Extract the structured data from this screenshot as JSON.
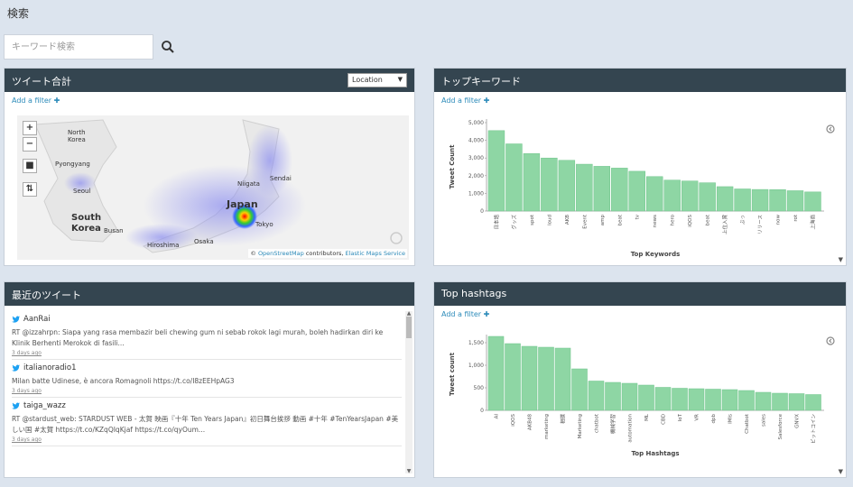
{
  "page": {
    "title": "検索"
  },
  "search": {
    "placeholder": "キーワード検索"
  },
  "panels": {
    "tweet_total": {
      "title": "ツイート合計",
      "select_value": "Location",
      "filter_label": "Add a filter"
    },
    "top_keywords": {
      "title": "トップキーワード",
      "filter_label": "Add a filter"
    },
    "recent_tweets": {
      "title": "最近のツイート"
    },
    "top_hashtags": {
      "title": "Top hashtags",
      "filter_label": "Add a filter"
    }
  },
  "map": {
    "labels": {
      "north_korea": "North\nKorea",
      "pyongyang": "Pyongyang",
      "seoul": "Seoul",
      "south_korea": "South\nKorea",
      "busan": "Busan",
      "japan": "Japan",
      "niigata": "Niigata",
      "sendai": "Sendai",
      "tokyo": "Tokyo",
      "osaka": "Osaka",
      "hiroshima": "Hiroshima"
    },
    "attribution_prefix": "© ",
    "attribution_osm": "OpenStreetMap",
    "attribution_mid": " contributors, ",
    "attribution_ems": "Elastic Maps Service"
  },
  "tweets": [
    {
      "user": "AanRai",
      "text": "RT @izzahrpn: Siapa yang rasa membazir beli chewing gum ni sebab rokok lagi murah, boleh hadirkan diri ke Klinik Berhenti Merokok di fasili...",
      "time": "3 days ago"
    },
    {
      "user": "italianoradio1",
      "text": "Milan batte Udinese, è ancora Romagnoli https://t.co/I8zEEHpAG3",
      "time": "3 days ago"
    },
    {
      "user": "taiga_wazz",
      "text": "RT @stardust_web: STARDUST WEB - 太賀 映画『十年 Ten Years Japan』初日舞台挨拶 動画 #十年 #TenYearsJapan #美しい国 #太賀 https://t.co/KZqQIqKjaf https://t.co/qyOum...",
      "time": "3 days ago"
    }
  ],
  "colors": {
    "header": "#344550",
    "bar": "#8ed6a4",
    "bar_stroke": "#6fc48b",
    "link": "#2b8ab9",
    "background": "#dce4ee"
  },
  "chart_data": [
    {
      "type": "bar",
      "title": "",
      "xlabel": "Top Keywords",
      "ylabel": "Tweet Count",
      "ylim": [
        0,
        5000
      ],
      "yticks": [
        "0",
        "1,000",
        "2,000",
        "3,000",
        "4,000",
        "5,000"
      ],
      "categories": [
        "日本語",
        "グッズ",
        "spot",
        "loud",
        "AKB",
        "Event",
        "amp",
        "beat",
        "tv",
        "news",
        "hero",
        "iQOS",
        "beat",
        "上位入賞",
        "ぶっ",
        "リリース",
        "now",
        "rot",
        "上海商"
      ],
      "values": [
        4550,
        3800,
        3250,
        3000,
        2870,
        2650,
        2530,
        2430,
        2250,
        1950,
        1750,
        1700,
        1600,
        1380,
        1250,
        1220,
        1210,
        1150,
        1080
      ]
    },
    {
      "type": "bar",
      "title": "",
      "xlabel": "Top Hashtags",
      "ylabel": "Tweet count",
      "ylim": [
        0,
        1600
      ],
      "yticks": [
        "0",
        "500",
        "1,000",
        "1,500"
      ],
      "categories": [
        "AI",
        "iQOS",
        "AKB48",
        "marketing",
        "相撲",
        "Marketing",
        "chatbot",
        "機械学習",
        "automation",
        "ML",
        "CBD",
        "IoT",
        "VR",
        "dpb",
        "IMIs",
        "Chatbot",
        "sales",
        "Salesforce",
        "GNVX",
        "ビットコイン"
      ],
      "values": [
        1640,
        1480,
        1420,
        1400,
        1380,
        920,
        650,
        620,
        600,
        560,
        510,
        490,
        480,
        470,
        460,
        440,
        400,
        380,
        370,
        350
      ]
    }
  ]
}
